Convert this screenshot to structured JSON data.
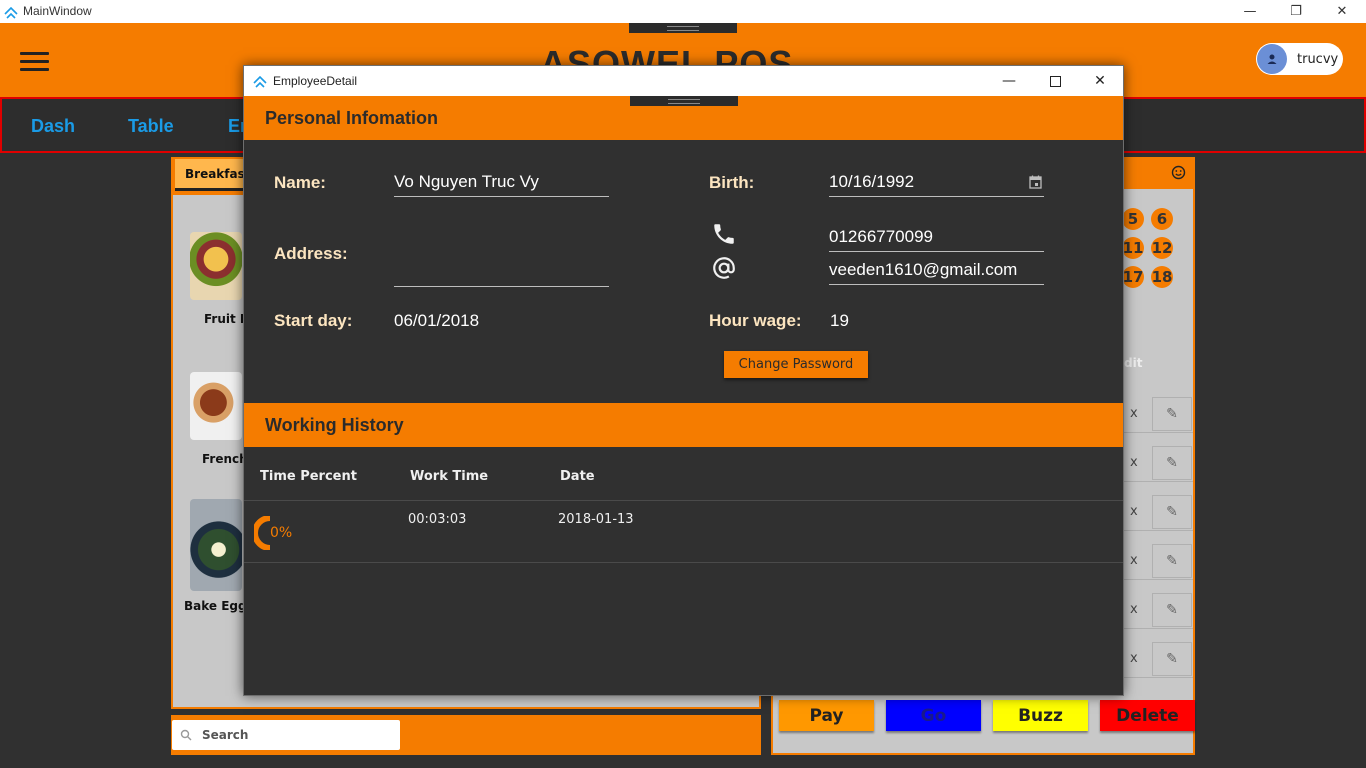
{
  "window": {
    "title": "MainWindow",
    "minimize_glyph": "—",
    "restore_glyph": "❐",
    "close_glyph": "✕"
  },
  "header": {
    "app_title": "ASOWEL POS",
    "user_name": "trucvy",
    "accent_color": "#f57c00"
  },
  "nav": {
    "tabs": [
      {
        "label": "Dash"
      },
      {
        "label": "Table"
      },
      {
        "label": "Em"
      }
    ]
  },
  "menu": {
    "active_tab": "Breakfast",
    "items": [
      {
        "label": "Fruit F"
      },
      {
        "label": "French"
      },
      {
        "label": "Bake Eggs"
      }
    ],
    "search_placeholder": "Search"
  },
  "order": {
    "edit_label": "dit",
    "table_numbers": [
      "5",
      "6",
      "11",
      "12",
      "17",
      "18"
    ],
    "row_delete_glyph": "x",
    "row_edit_glyph": "✎",
    "actions": [
      {
        "label": "Pay",
        "color": "#ff9800"
      },
      {
        "label": "Go",
        "color": "#0000ff"
      },
      {
        "label": "Buzz",
        "color": "#ffff00"
      },
      {
        "label": "Delete",
        "color": "#ff0000"
      }
    ]
  },
  "dialog": {
    "title": "EmployeeDetail",
    "personal_header": "Personal Infomation",
    "name_label": "Name:",
    "name_value": "Vo Nguyen Truc Vy",
    "birth_label": "Birth:",
    "birth_value": "10/16/1992",
    "address_label": "Address:",
    "address_value": "",
    "phone_value": "01266770099",
    "email_value": "veeden1610@gmail.com",
    "start_label": "Start day:",
    "start_value": "06/01/2018",
    "wage_label": "Hour wage:",
    "wage_value": "19",
    "change_password_label": "Change Password",
    "history_header": "Working History",
    "history_columns": [
      "Time Percent",
      "Work Time",
      "Date"
    ],
    "history_rows": [
      {
        "percent": "0%",
        "work_time": "00:03:03",
        "date": "2018-01-13"
      }
    ]
  }
}
